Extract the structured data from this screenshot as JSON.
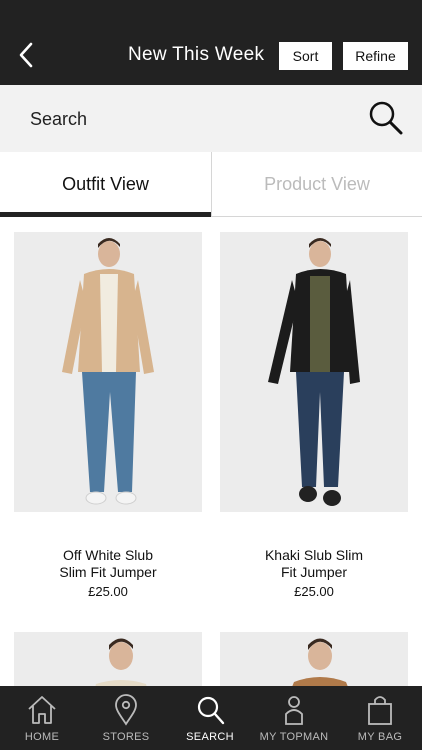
{
  "header": {
    "title": "New This Week",
    "sort_label": "Sort",
    "refine_label": "Refine"
  },
  "search": {
    "placeholder": "Search"
  },
  "tabs": [
    {
      "label": "Outfit View",
      "active": true
    },
    {
      "label": "Product View",
      "active": false
    }
  ],
  "products": [
    {
      "name_line1": "Off White Slub",
      "name_line2": "Slim Fit Jumper",
      "price": "£25.00",
      "jacket_color": "#d7b48e",
      "top_color": "#f1ece0",
      "jeans_color": "#4f7aa0",
      "shoes_color": "#f4f4f4"
    },
    {
      "name_line1": "Khaki Slub Slim",
      "name_line2": "Fit Jumper",
      "price": "£25.00",
      "jacket_color": "#1c1c1c",
      "top_color": "#5a5c3e",
      "jeans_color": "#2a3f5c",
      "shoes_color": "#222222"
    },
    {
      "name_line1": "",
      "name_line2": "",
      "price": ""
    },
    {
      "name_line1": "",
      "name_line2": "",
      "price": ""
    }
  ],
  "tabbar": {
    "items": [
      {
        "label": "HOME",
        "icon": "home-icon",
        "active": false
      },
      {
        "label": "STORES",
        "icon": "map-pin-icon",
        "active": false
      },
      {
        "label": "SEARCH",
        "icon": "search-icon",
        "active": true
      },
      {
        "label": "MY TOPMAN",
        "icon": "user-icon",
        "active": false
      },
      {
        "label": "MY BAG",
        "icon": "bag-icon",
        "active": false
      }
    ]
  },
  "colors": {
    "header_bg": "#222222",
    "search_bg": "#f2f2f2",
    "inactive_tab_text": "#bbbbbb"
  }
}
